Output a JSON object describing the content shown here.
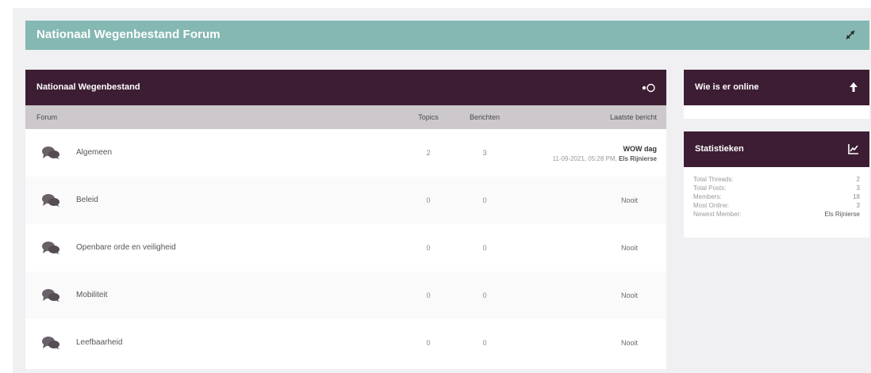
{
  "banner": {
    "title": "Nationaal Wegenbestand Forum"
  },
  "forum": {
    "title": "Nationaal Wegenbestand",
    "columns": {
      "forum": "Forum",
      "topics": "Topics",
      "posts": "Berichten",
      "last": "Laatste bericht"
    },
    "rows": [
      {
        "name": "Algemeen",
        "topics": "2",
        "posts": "3",
        "last_title": "WOW dag",
        "last_meta": "11-09-2021, 05:28 PM,",
        "last_user": "Els Rijnierse"
      },
      {
        "name": "Beleid",
        "topics": "0",
        "posts": "0",
        "last": "Nooit"
      },
      {
        "name": "Openbare orde en veiligheid",
        "topics": "0",
        "posts": "0",
        "last": "Nooit"
      },
      {
        "name": "Mobiliteit",
        "topics": "0",
        "posts": "0",
        "last": "Nooit"
      },
      {
        "name": "Leefbaarheid",
        "topics": "0",
        "posts": "0",
        "last": "Nooit"
      }
    ]
  },
  "online": {
    "title": "Wie is er online"
  },
  "stats": {
    "title": "Statistieken",
    "items": [
      {
        "label": "Total Threads:",
        "value": "2"
      },
      {
        "label": "Total Posts:",
        "value": "3"
      },
      {
        "label": "Members:",
        "value": "18"
      },
      {
        "label": "Most Online:",
        "value": "3"
      },
      {
        "label": "Newest Member:",
        "value": "Els Rijnierse"
      }
    ]
  },
  "colors": {
    "banner": "#86b8b3",
    "panel_header": "#3d1d34",
    "column_header": "#ccc8cb",
    "canvas": "#f0f0f2"
  },
  "icons": {
    "expand": "arrows-diagonal-icon",
    "toggle": "toggle-icon",
    "forum": "chat-bubbles-icon",
    "online": "arrow-up-icon",
    "stats": "chart-line-icon"
  }
}
